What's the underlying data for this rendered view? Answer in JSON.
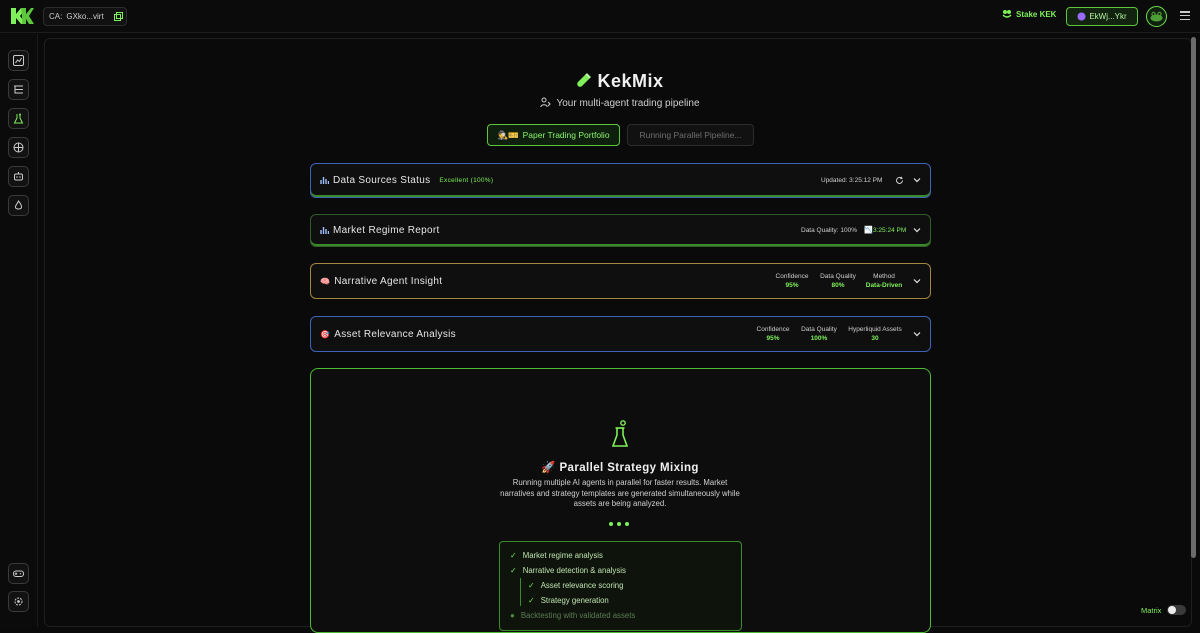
{
  "topbar": {
    "ca_label": "CA:",
    "ca_value": "GXko...virt",
    "stake_label": "Stake KEK",
    "wallet_label": "EkWj...Ykr"
  },
  "header": {
    "title": "KekMix",
    "subtitle": "Your multi-agent trading pipeline",
    "paper_button": "Paper Trading Portfolio",
    "running_button": "Running Parallel Pipeline..."
  },
  "panels": {
    "data_sources": {
      "title": "Data Sources Status",
      "status": "Excellent (100%)",
      "updated": "Updated: 3:25:12 PM"
    },
    "market_regime": {
      "title": "Market Regime Report",
      "quality": "Data Quality: 100%",
      "time": "3:25:24 PM"
    },
    "narrative": {
      "title": "Narrative Agent Insight",
      "m1_label": "Confidence",
      "m1_value": "95%",
      "m2_label": "Data Quality",
      "m2_value": "80%",
      "m3_label": "Method",
      "m3_value": "Data-Driven"
    },
    "asset": {
      "title": "Asset Relevance Analysis",
      "m1_label": "Confidence",
      "m1_value": "95%",
      "m2_label": "Data Quality",
      "m2_value": "100%",
      "m3_label": "Hyperliquid Assets",
      "m3_value": "30"
    }
  },
  "mixing": {
    "title": "🚀 Parallel Strategy Mixing",
    "description": "Running multiple AI agents in parallel for faster results. Market narratives and strategy templates are generated simultaneously while assets are being analyzed.",
    "steps": [
      "Market regime analysis",
      "Narrative detection & analysis",
      "Asset relevance scoring",
      "Strategy generation",
      "Backtesting with validated assets"
    ]
  },
  "footer": {
    "matrix_label": "Matrix"
  },
  "colors": {
    "accent": "#7ef05a",
    "background": "#0a0a0a",
    "panel_border_green": "#4dbb33",
    "panel_border_blue": "#3f63b8",
    "panel_border_gold": "#a3873f"
  }
}
